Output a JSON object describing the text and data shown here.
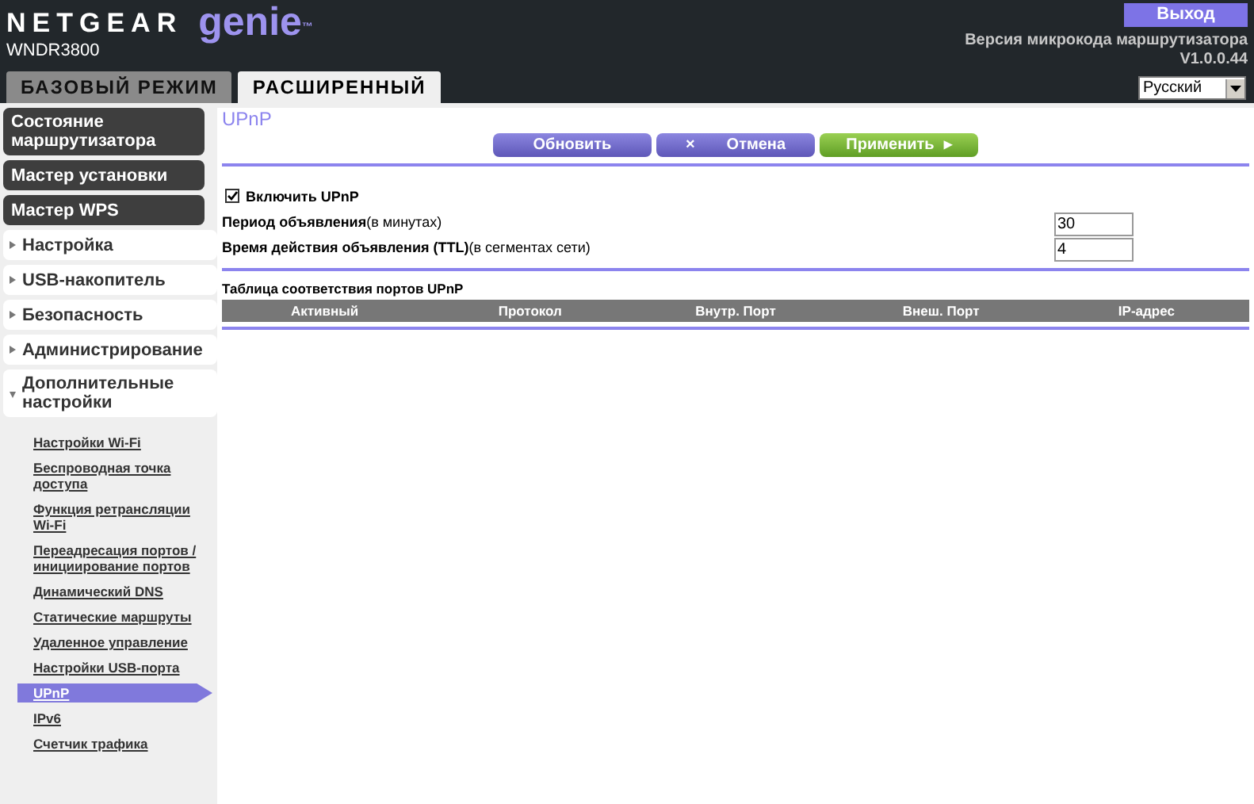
{
  "header": {
    "brand": "NETGEAR",
    "product": "genie",
    "trademark": "™",
    "model": "WNDR3800",
    "logout": "Выход",
    "firmware_label": "Версия микрокода маршрутизатора",
    "firmware_version": "V1.0.0.44",
    "language": "Русский"
  },
  "tabs": [
    {
      "label": "БАЗОВЫЙ РЕЖИМ",
      "selected": false
    },
    {
      "label": "РАСШИРЕННЫЙ",
      "selected": true
    }
  ],
  "sidebar": {
    "items": [
      {
        "kind": "dark",
        "label": "Состояние маршрутизатора"
      },
      {
        "kind": "dark",
        "label": "Мастер установки"
      },
      {
        "kind": "dark",
        "label": "Мастер WPS"
      },
      {
        "kind": "section",
        "label": "Настройка",
        "expanded": false
      },
      {
        "kind": "section",
        "label": "USB-накопитель",
        "expanded": false
      },
      {
        "kind": "section",
        "label": "Безопасность",
        "expanded": false
      },
      {
        "kind": "section",
        "label": "Администрирование",
        "expanded": false
      },
      {
        "kind": "section",
        "label": "Дополнительные настройки",
        "expanded": true,
        "children": [
          {
            "label": "Настройки Wi-Fi",
            "selected": false
          },
          {
            "label": "Беспроводная точка доступа",
            "selected": false
          },
          {
            "label": "Функция ретрансляции Wi-Fi",
            "selected": false
          },
          {
            "label": "Переадресация портов / инициирование портов",
            "selected": false
          },
          {
            "label": "Динамический DNS",
            "selected": false
          },
          {
            "label": "Статические маршруты",
            "selected": false
          },
          {
            "label": "Удаленное управление",
            "selected": false
          },
          {
            "label": "Настройки USB-порта",
            "selected": false
          },
          {
            "label": "UPnP",
            "selected": true
          },
          {
            "label": "IPv6",
            "selected": false
          },
          {
            "label": "Счетчик трафика",
            "selected": false
          }
        ]
      }
    ]
  },
  "page": {
    "title": "UPnP",
    "buttons": [
      {
        "kind": "refresh",
        "label": "Обновить"
      },
      {
        "kind": "cancel",
        "label": "Отмена",
        "icon": "×"
      },
      {
        "kind": "apply",
        "label": "Применить",
        "icon": "▸"
      }
    ],
    "enable": {
      "label": "Включить UPnP",
      "checked": true
    },
    "fields": [
      {
        "label": "**Период объявления**(в минутах)",
        "value": "30"
      },
      {
        "label": "**Время действия объявления (TTL)**(в сегментах сети)",
        "value": "4"
      }
    ],
    "table": {
      "title": "Таблица соответствия портов UPnP",
      "columns": [
        "Активный",
        "Протокол",
        "Внутр. Порт",
        "Внеш. Порт",
        "IP-адрес"
      ]
    }
  }
}
